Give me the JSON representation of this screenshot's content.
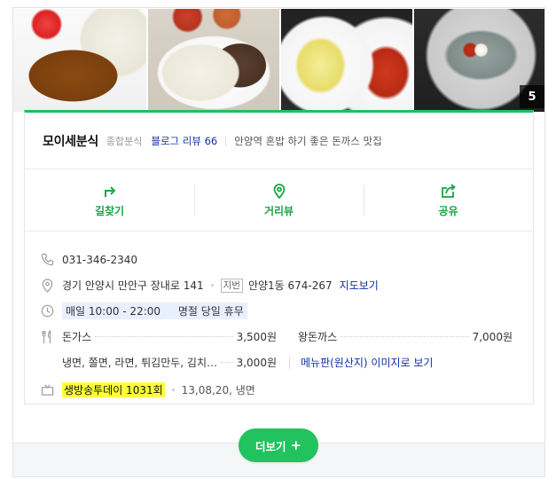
{
  "place": {
    "name": "모이세분식",
    "category": "종합분식",
    "blog_review": "블로그 리뷰 66",
    "description": "안양역 혼밥 하기 좋은 돈까스 맛집",
    "photo_count": "5"
  },
  "actions": [
    {
      "label": "길찾기",
      "icon": "directions-icon"
    },
    {
      "label": "거리뷰",
      "icon": "street-view-pin-icon"
    },
    {
      "label": "공유",
      "icon": "share-icon"
    }
  ],
  "details": {
    "phone": "031-346-2340",
    "address": "경기 안양시 만안구 장내로 141",
    "jibeon_badge": "지번",
    "jibeon_address": "안양1동 674-267",
    "map_link": "지도보기",
    "hours": "매일 10:00 - 22:00",
    "holiday": "명절 당일 휴무",
    "menu": [
      {
        "name": "돈가스",
        "price": "3,500원"
      },
      {
        "name": "왕돈까스",
        "price": "7,000원"
      },
      {
        "name": "냉면, 쫄면, 라면, 튀김만두, 김치…",
        "price": "3,000원"
      }
    ],
    "menu_image_link": "메뉴판(원산지) 이미지로 보기",
    "tv_show": "생방송투데이 1031회",
    "tv_meta": "13,08,20, 냉면"
  },
  "more_button": {
    "label": "더보기",
    "plus": "+"
  },
  "colors": {
    "accent_green": "#1fc15a",
    "link_blue": "#112fa0",
    "highlight_yellow": "#ffff3a"
  }
}
